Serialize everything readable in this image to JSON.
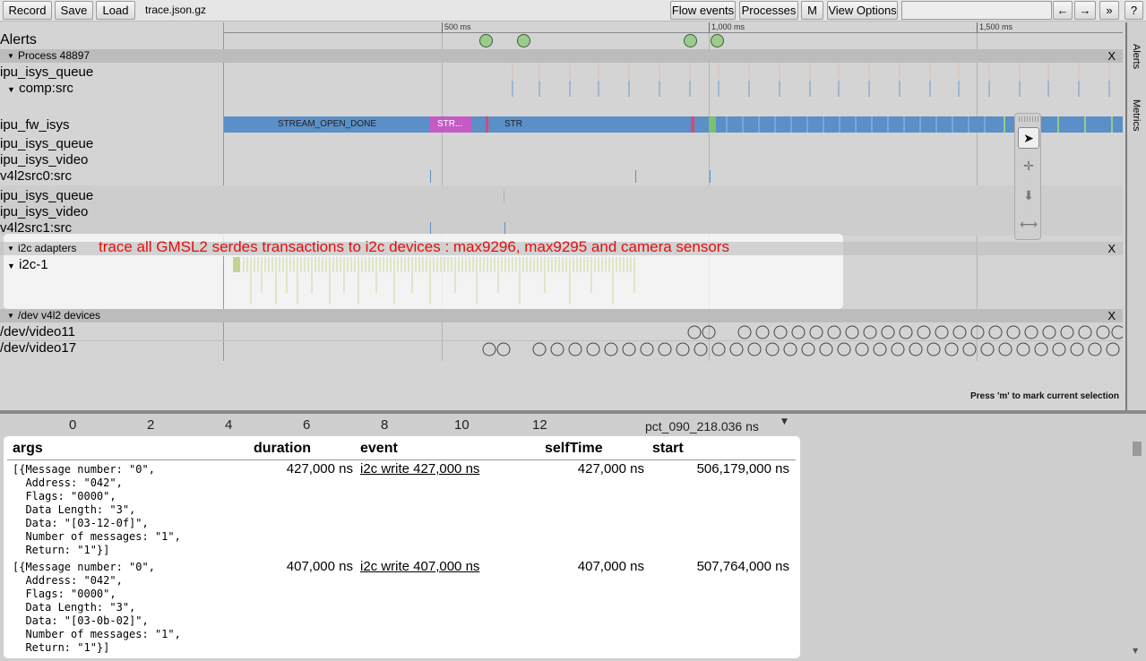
{
  "toolbar": {
    "record": "Record",
    "save": "Save",
    "load": "Load",
    "filename": "trace.json.gz",
    "flow_events": "Flow events",
    "processes": "Processes",
    "m": "M",
    "view_options": "View Options",
    "back": "←",
    "forward": "→",
    "more": "»",
    "help": "?"
  },
  "ruler": {
    "t500": "500 ms",
    "t1000": "1,000 ms",
    "t1500": "1,500 ms"
  },
  "tracks": {
    "alerts": "Alerts",
    "process_header": "Process 48897",
    "ipu_isys_queue_1": "ipu_isys_queue",
    "comp_src": "comp:src",
    "ipu_fw_isys": "ipu_fw_isys",
    "ipu_isys_queue_2": "ipu_isys_queue",
    "ipu_isys_video_1": "ipu_isys_video",
    "v4l2src0": "v4l2src0:src",
    "ipu_isys_queue_3": "ipu_isys_queue",
    "ipu_isys_video_2": "ipu_isys_video",
    "v4l2src1": "v4l2src1:src",
    "i2c_header": "i2c adapters",
    "i2c1": "i2c-1",
    "v4l2_header": "/dev v4l2 devices",
    "video11": "/dev/video11",
    "video17": "/dev/video17",
    "close": "X"
  },
  "slices": {
    "s1": "STREAM_OPEN_DONE",
    "s2": "STR...",
    "s3": "STR"
  },
  "annotation": "trace all GMSL2 serdes transactions to i2c devices : max9296, max9295 and camera sensors",
  "hint": "Press 'm' to mark current selection",
  "sidepanel": {
    "alerts": "Alerts",
    "metrics": "Metrics"
  },
  "bottom_axis": [
    "0",
    "2",
    "4",
    "6",
    "8",
    "10",
    "12"
  ],
  "selection_header": "pct_090_218.036 ns",
  "table": {
    "headers": {
      "args": "args",
      "duration": "duration",
      "event": "event",
      "selfTime": "selfTime",
      "start": "start"
    },
    "rows": [
      {
        "args": "[{Message number: \"0\",\n  Address: \"042\",\n  Flags: \"0000\",\n  Data Length: \"3\",\n  Data: \"[03-12-0f]\",\n  Number of messages: \"1\",\n  Return: \"1\"}]",
        "duration": "427,000 ns",
        "event": "i2c write 427,000 ns",
        "selfTime": "427,000 ns",
        "start": "506,179,000 ns"
      },
      {
        "args": "[{Message number: \"0\",\n  Address: \"042\",\n  Flags: \"0000\",\n  Data Length: \"3\",\n  Data: \"[03-0b-02]\",\n  Number of messages: \"1\",\n  Return: \"1\"}]",
        "duration": "407,000 ns",
        "event": "i2c write 407,000 ns",
        "selfTime": "407,000 ns",
        "start": "507,764,000 ns"
      }
    ]
  },
  "colors": {
    "slice_blue": "#5b8fc7",
    "slice_magenta": "#c45bc4",
    "alert_green": "#9ccc8c",
    "annotation_red": "#e01010"
  }
}
